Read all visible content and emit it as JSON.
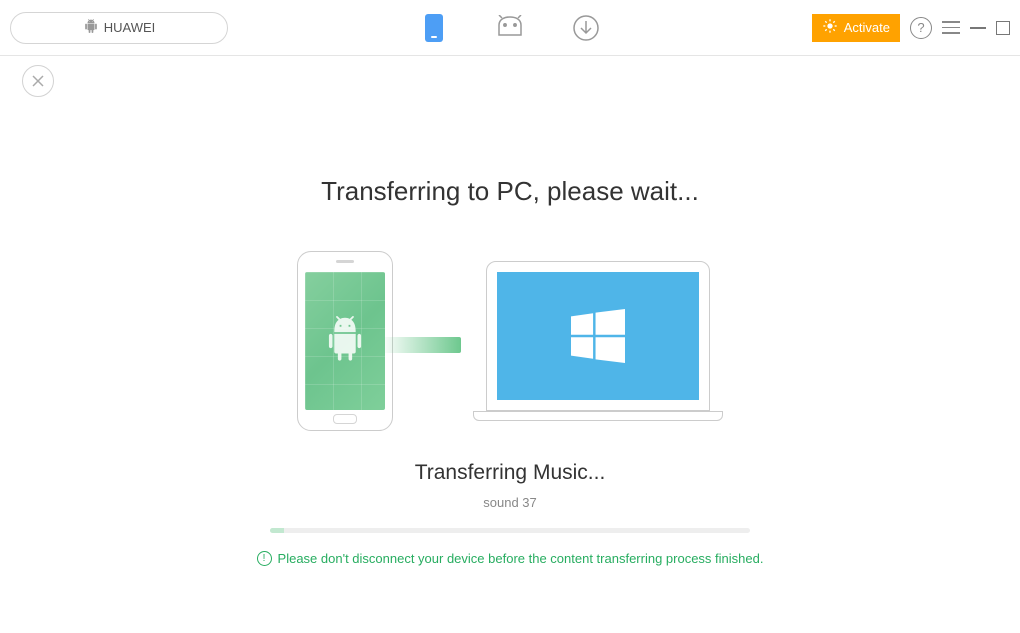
{
  "header": {
    "device_name": "HUAWEI",
    "activate_label": "Activate"
  },
  "main": {
    "title": "Transferring to PC, please wait...",
    "status": "Transferring Music...",
    "current_file": "sound 37",
    "warning": "Please don't disconnect your device before the content transferring process finished."
  }
}
